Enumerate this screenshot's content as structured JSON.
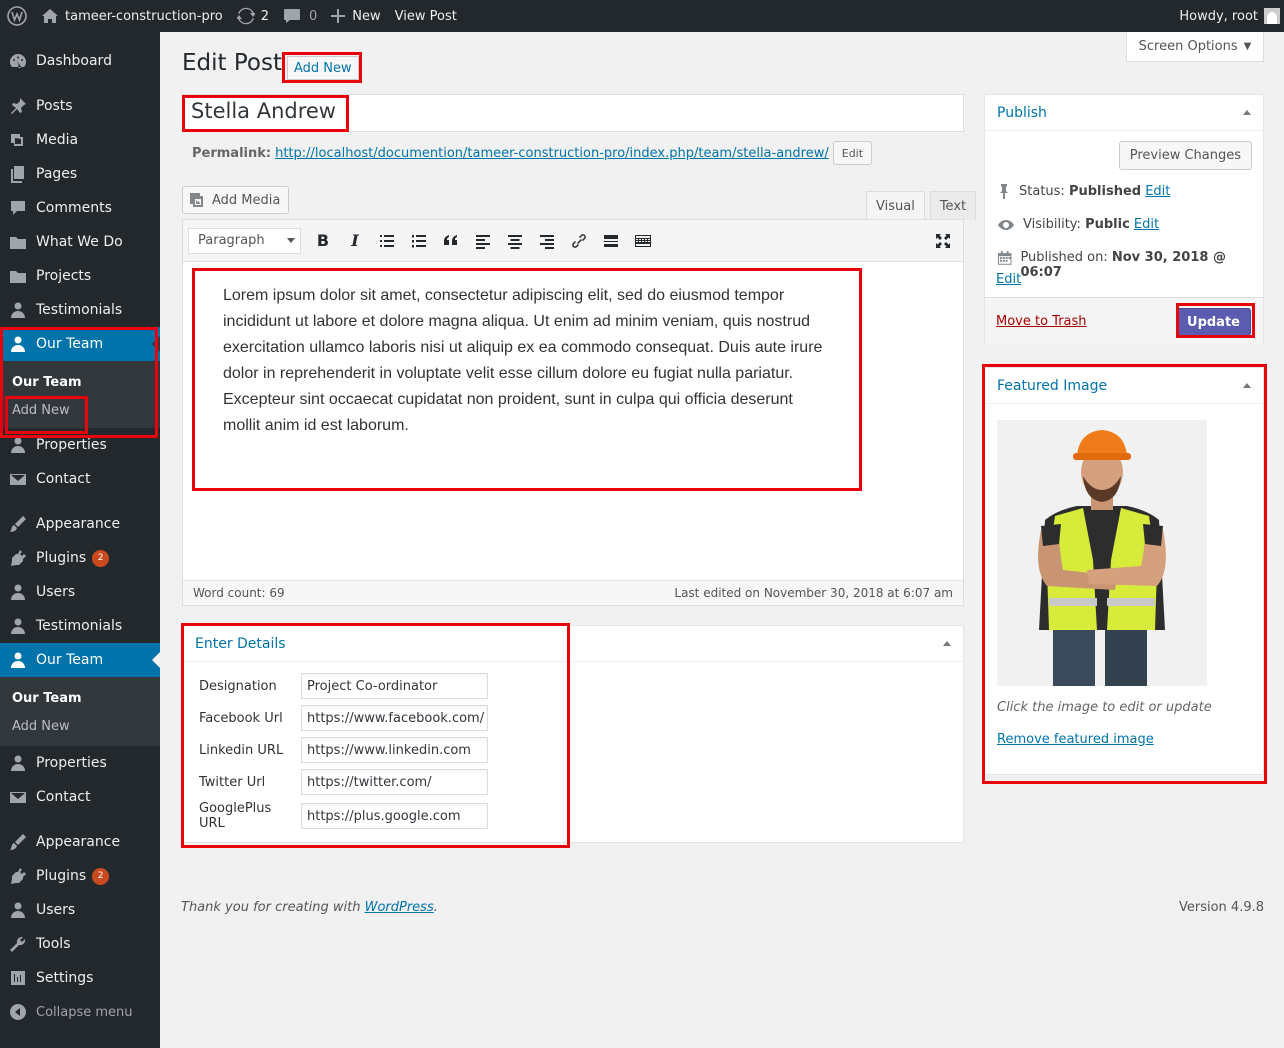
{
  "admin_bar": {
    "site_name": "tameer-construction-pro",
    "updates_count": "2",
    "comments_count": "0",
    "new_label": "New",
    "view_post_label": "View Post",
    "howdy": "Howdy, root"
  },
  "sidebar": {
    "items": [
      {
        "label": "Dashboard"
      },
      {
        "label": "Posts"
      },
      {
        "label": "Media"
      },
      {
        "label": "Pages"
      },
      {
        "label": "Comments"
      },
      {
        "label": "What We Do"
      },
      {
        "label": "Projects"
      },
      {
        "label": "Testimonials"
      },
      {
        "label": "Our Team"
      },
      {
        "label": "Properties"
      },
      {
        "label": "Contact"
      },
      {
        "label": "Appearance"
      },
      {
        "label": "Plugins",
        "badge": "2"
      },
      {
        "label": "Users"
      },
      {
        "label": "Testimonials"
      },
      {
        "label": "Our Team"
      },
      {
        "label": "Properties"
      },
      {
        "label": "Contact"
      },
      {
        "label": "Appearance"
      },
      {
        "label": "Plugins",
        "badge": "2"
      },
      {
        "label": "Users"
      },
      {
        "label": "Tools"
      },
      {
        "label": "Settings"
      },
      {
        "label": "Collapse menu"
      }
    ],
    "submenu_a": {
      "our_team": "Our Team",
      "add_new": "Add New"
    },
    "submenu_b": {
      "our_team": "Our Team",
      "add_new": "Add New"
    }
  },
  "header": {
    "page_title": "Edit Post",
    "add_new": "Add New",
    "screen_options": "Screen Options"
  },
  "post": {
    "title": "Stella Andrew",
    "permalink_label": "Permalink:",
    "permalink_url": "http://localhost/documention/tameer-construction-pro/index.php/team/stella-andrew/",
    "permalink_edit": "Edit",
    "add_media": "Add Media",
    "tab_visual": "Visual",
    "tab_text": "Text",
    "format_select": "Paragraph",
    "content": "Lorem ipsum dolor sit amet, consectetur adipiscing elit, sed do eiusmod tempor incididunt ut labore et dolore magna aliqua. Ut enim ad minim veniam, quis nostrud exercitation ullamco laboris nisi ut aliquip ex ea commodo consequat. Duis aute irure dolor in reprehenderit in voluptate velit esse cillum dolore eu fugiat nulla pariatur. Excepteur sint occaecat cupidatat non proident, sunt in culpa qui officia deserunt mollit anim id est laborum.",
    "word_count": "Word count: 69",
    "last_edited": "Last edited on November 30, 2018 at 6:07 am"
  },
  "details": {
    "title": "Enter Details",
    "fields": [
      {
        "label": "Designation",
        "value": "Project Co-ordinator"
      },
      {
        "label": "Facebook Url",
        "value": "https://www.facebook.com/"
      },
      {
        "label": "Linkedin URL",
        "value": "https://www.linkedin.com"
      },
      {
        "label": "Twitter Url",
        "value": "https://twitter.com/"
      },
      {
        "label": "GooglePlus URL",
        "value": "https://plus.google.com"
      }
    ]
  },
  "publish": {
    "title": "Publish",
    "preview": "Preview Changes",
    "status_label": "Status:",
    "status_value": "Published",
    "visibility_label": "Visibility:",
    "visibility_value": "Public",
    "published_on_label": "Published on:",
    "published_on_value": "Nov 30, 2018 @ 06:07",
    "edit": "Edit",
    "trash": "Move to Trash",
    "update": "Update"
  },
  "featured": {
    "title": "Featured Image",
    "hint": "Click the image to edit or update",
    "remove": "Remove featured image"
  },
  "footer": {
    "thanks": "Thank you for creating with",
    "wp_link": "WordPress",
    "period": ".",
    "version": "Version 4.9.8"
  },
  "colors": {
    "annotation_red": "#e8000b",
    "wp_blue": "#0073aa",
    "update_button": "#5b5bb0"
  }
}
